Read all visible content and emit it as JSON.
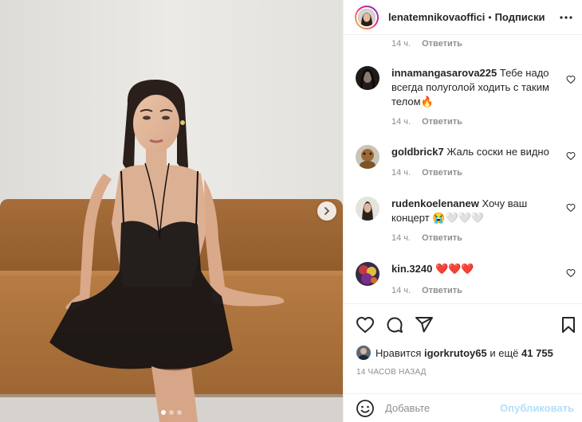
{
  "post": {
    "author": "lenatemnikovaoffici",
    "separator": "•",
    "follow_label": "Подписки",
    "more_icon": "more-horizontal-icon"
  },
  "photo": {
    "slide_count": 3,
    "active_slide": 1,
    "next_icon": "chevron-right-icon"
  },
  "comments": {
    "top_meta": {
      "time": "14 ч.",
      "reply_label": "Ответить"
    },
    "items": [
      {
        "user": "innamangasarova225",
        "text": "Тебе надо всегда полуголой ходить с таким телом🔥",
        "time": "14 ч.",
        "reply_label": "Ответить"
      },
      {
        "user": "goldbrick7",
        "text": "Жаль соски не видно",
        "time": "14 ч.",
        "reply_label": "Ответить"
      },
      {
        "user": "rudenkoelenanew",
        "text": "Хочу ваш концерт 😭🤍🤍🤍",
        "time": "14 ч.",
        "reply_label": "Ответить"
      },
      {
        "user": "kin.3240",
        "text": "❤️❤️❤️",
        "time": "14 ч.",
        "reply_label": "Ответить"
      }
    ]
  },
  "actions": {
    "like_icon": "heart-icon",
    "comment_icon": "comment-icon",
    "share_icon": "share-icon",
    "save_icon": "bookmark-icon"
  },
  "likes": {
    "prefix": "Нравится",
    "user": "igorkrutoy65",
    "middle": "и ещё",
    "count": "41 755"
  },
  "time_ago": "14 ЧАСОВ НАЗАД",
  "add_comment": {
    "placeholder": "Добавьте",
    "post_label": "Опубликовать",
    "post_color": "#b2dffc"
  },
  "colors": {
    "text": "#262626",
    "muted": "#8e8e8e",
    "border": "#efefef"
  }
}
